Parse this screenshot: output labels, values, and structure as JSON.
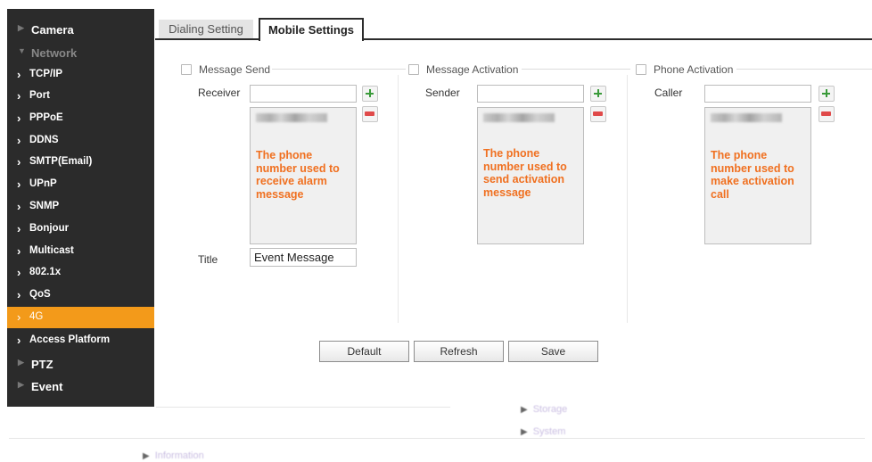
{
  "sidebar": {
    "top_items": [
      {
        "label": "Camera",
        "expanded": false
      },
      {
        "label": "Network",
        "expanded": true
      },
      {
        "label": "PTZ",
        "expanded": false
      },
      {
        "label": "Event",
        "expanded": false
      }
    ],
    "network_items": [
      {
        "label": "TCP/IP"
      },
      {
        "label": "Port"
      },
      {
        "label": "PPPoE"
      },
      {
        "label": "DDNS"
      },
      {
        "label": "SMTP(Email)"
      },
      {
        "label": "UPnP"
      },
      {
        "label": "SNMP"
      },
      {
        "label": "Bonjour"
      },
      {
        "label": "Multicast"
      },
      {
        "label": "802.1x"
      },
      {
        "label": "QoS"
      },
      {
        "label": "4G",
        "active": true
      },
      {
        "label": "Access Platform"
      }
    ],
    "active_color": "#f39a1a"
  },
  "tabs": [
    {
      "label": "Dialing Setting",
      "active": false
    },
    {
      "label": "Mobile Settings",
      "active": true
    }
  ],
  "sections": {
    "message_send": {
      "legend": "Message Send",
      "field_label": "Receiver",
      "input_value": "",
      "note": "The phone number used to receive alarm message",
      "title_label": "Title",
      "title_value": "Event Message"
    },
    "message_activation": {
      "legend": "Message Activation",
      "field_label": "Sender",
      "input_value": "",
      "note": "The phone number used to send activation message"
    },
    "phone_activation": {
      "legend": "Phone Activation",
      "field_label": "Caller",
      "input_value": "",
      "note": "The phone number used to make activation call"
    }
  },
  "buttons": {
    "default": "Default",
    "refresh": "Refresh",
    "save": "Save"
  },
  "bottom_links": {
    "storage": "Storage",
    "system": "System",
    "information": "Information"
  },
  "colors": {
    "note": "#f07020",
    "plus": "#3a9a3a",
    "minus": "#e04a4a"
  }
}
